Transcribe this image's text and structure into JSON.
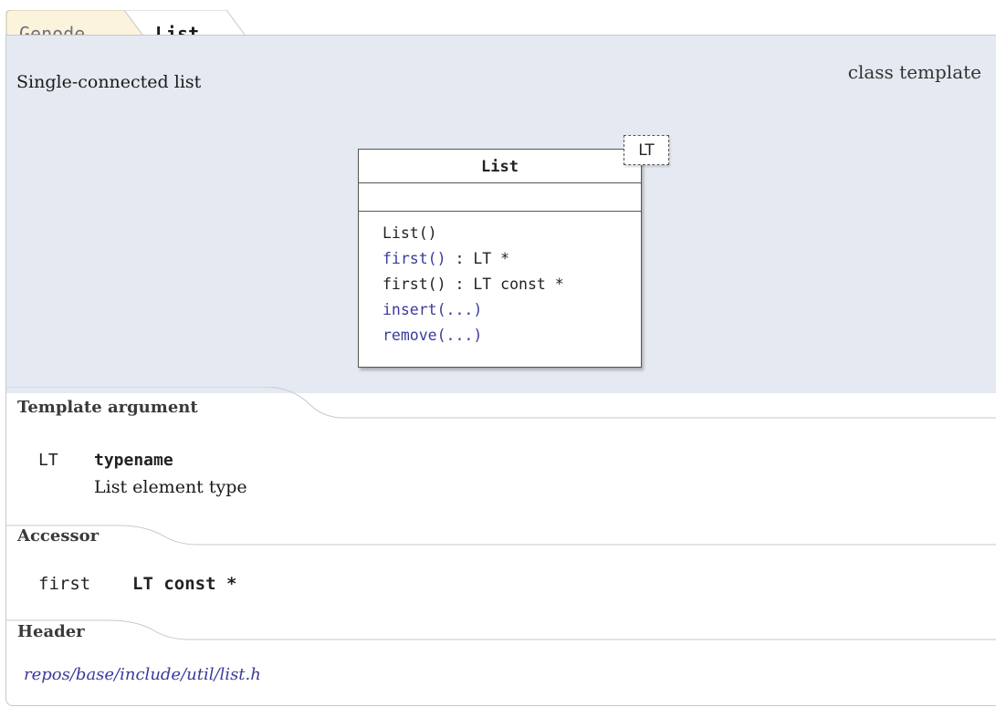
{
  "breadcrumb": {
    "items": [
      "Genode",
      "List"
    ]
  },
  "brief": "Single-connected list",
  "kind": "class template",
  "uml": {
    "class_name": "List",
    "template_param": "LT",
    "operations": [
      {
        "name": "List()",
        "type": "",
        "link": false
      },
      {
        "name": "first()",
        "type": " : LT *",
        "link": true
      },
      {
        "name": "first()",
        "type": " : LT const *",
        "link": false
      },
      {
        "name": "insert(...)",
        "type": "",
        "link": true
      },
      {
        "name": "remove(...)",
        "type": "",
        "link": true
      }
    ]
  },
  "template_argument": {
    "title": "Template argument",
    "name": "LT",
    "type": "typename",
    "description": "List element type"
  },
  "accessor": {
    "title": "Accessor",
    "name": "first",
    "type": "LT const *"
  },
  "header": {
    "title": "Header",
    "path": "repos/base/include/util/list.h"
  },
  "colors": {
    "panel": "#e5e9f1",
    "link": "#3b3b9b",
    "crumb_first": "#fbf3dc"
  }
}
